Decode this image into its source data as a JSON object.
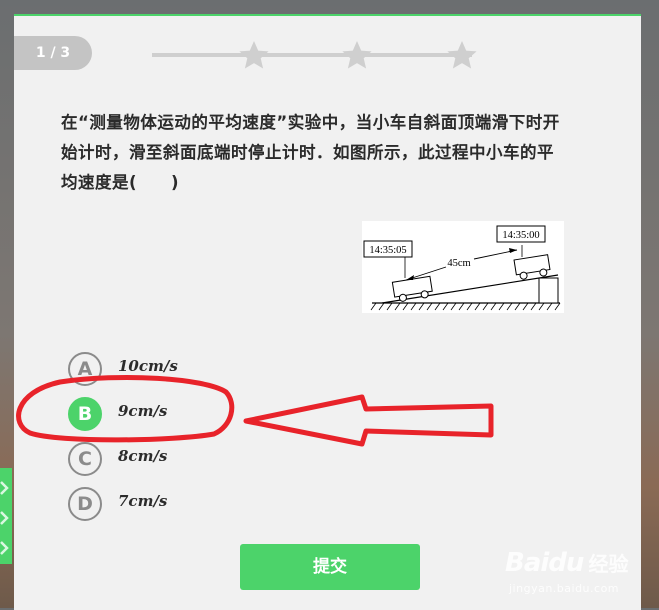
{
  "progress": {
    "label": "1 / 3",
    "star_count": 3,
    "stars_earned": 0
  },
  "question": {
    "line1": "在“测量物体运动的平均速度”实验中，当小车自斜面顶端滑下时开",
    "line2": "始计时，滑至斜面底端时停止计时．如图所示，此过程中小车的平",
    "line3": "均速度是(　　)"
  },
  "figure": {
    "time_start": "14:35:00",
    "time_end": "14:35:05",
    "distance": "45cm"
  },
  "options": [
    {
      "letter": "A",
      "text": "10cm/s",
      "selected": false
    },
    {
      "letter": "B",
      "text": "9cm/s",
      "selected": true
    },
    {
      "letter": "C",
      "text": "8cm/s",
      "selected": false
    },
    {
      "letter": "D",
      "text": "7cm/s",
      "selected": false
    }
  ],
  "submit_label": "提交",
  "watermark": {
    "brand": "Baidu",
    "suffix": "经验",
    "url": "jingyan.baidu.com"
  },
  "colors": {
    "accent": "#4cd36a",
    "annotation": "#e8232a",
    "card": "#f1f1f1"
  }
}
